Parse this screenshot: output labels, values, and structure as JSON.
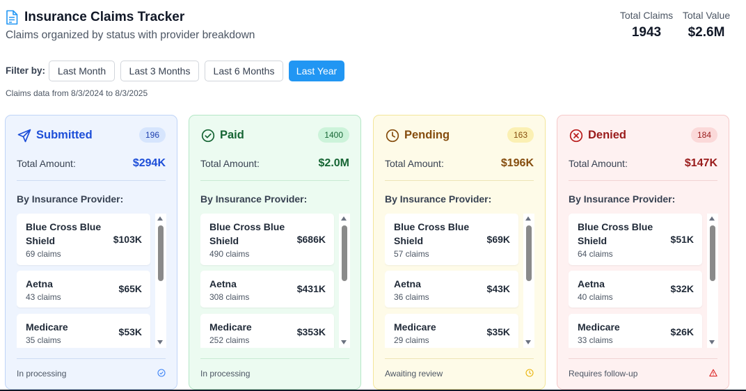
{
  "header": {
    "title": "Insurance Claims Tracker",
    "subtitle": "Claims organized by status with provider breakdown",
    "icon": "document-icon"
  },
  "summary": {
    "total_claims_label": "Total Claims",
    "total_claims_value": "1943",
    "total_value_label": "Total Value",
    "total_value_value": "$2.6M"
  },
  "filter": {
    "label": "Filter by:",
    "options": [
      "Last Month",
      "Last 3 Months",
      "Last 6 Months",
      "Last Year"
    ],
    "active": "Last Year",
    "date_range": "Claims data from 8/3/2024 to 8/3/2025"
  },
  "colors": {
    "accent": "#2196f3",
    "submitted": "#1d4ed8",
    "paid": "#166534",
    "pending": "#854d0e",
    "denied": "#991b1b"
  },
  "cards": [
    {
      "status": "Submitted",
      "icon": "send-icon",
      "count": "196",
      "amount_label": "Total Amount:",
      "amount": "$294K",
      "provider_heading": "By Insurance Provider:",
      "providers": [
        {
          "name": "Blue Cross Blue Shield",
          "claims": "69 claims",
          "amount": "$103K"
        },
        {
          "name": "Aetna",
          "claims": "43 claims",
          "amount": "$65K"
        },
        {
          "name": "Medicare",
          "claims": "35 claims",
          "amount": "$53K"
        }
      ],
      "footer": "In processing",
      "footer_icon": "check-circle-icon"
    },
    {
      "status": "Paid",
      "icon": "check-circle-icon",
      "count": "1400",
      "amount_label": "Total Amount:",
      "amount": "$2.0M",
      "provider_heading": "By Insurance Provider:",
      "providers": [
        {
          "name": "Blue Cross Blue Shield",
          "claims": "490 claims",
          "amount": "$686K"
        },
        {
          "name": "Aetna",
          "claims": "308 claims",
          "amount": "$431K"
        },
        {
          "name": "Medicare",
          "claims": "252 claims",
          "amount": "$353K"
        }
      ],
      "footer": "In processing",
      "footer_icon": ""
    },
    {
      "status": "Pending",
      "icon": "clock-icon",
      "count": "163",
      "amount_label": "Total Amount:",
      "amount": "$196K",
      "provider_heading": "By Insurance Provider:",
      "providers": [
        {
          "name": "Blue Cross Blue Shield",
          "claims": "57 claims",
          "amount": "$69K"
        },
        {
          "name": "Aetna",
          "claims": "36 claims",
          "amount": "$43K"
        },
        {
          "name": "Medicare",
          "claims": "29 claims",
          "amount": "$35K"
        }
      ],
      "footer": "Awaiting review",
      "footer_icon": "clock-icon"
    },
    {
      "status": "Denied",
      "icon": "x-circle-icon",
      "count": "184",
      "amount_label": "Total Amount:",
      "amount": "$147K",
      "provider_heading": "By Insurance Provider:",
      "providers": [
        {
          "name": "Blue Cross Blue Shield",
          "claims": "64 claims",
          "amount": "$51K"
        },
        {
          "name": "Aetna",
          "claims": "40 claims",
          "amount": "$32K"
        },
        {
          "name": "Medicare",
          "claims": "33 claims",
          "amount": "$26K"
        }
      ],
      "footer": "Requires follow-up",
      "footer_icon": "warning-icon"
    }
  ]
}
